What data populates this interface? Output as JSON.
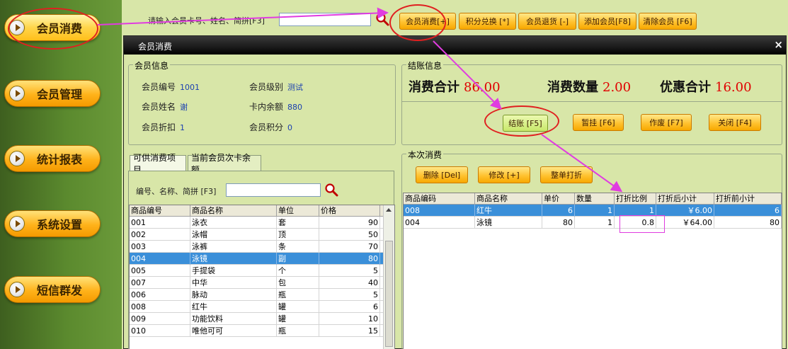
{
  "sidebar": {
    "items": [
      {
        "label": "会员消费"
      },
      {
        "label": "会员管理"
      },
      {
        "label": "统计报表"
      },
      {
        "label": "系统设置"
      },
      {
        "label": "短信群发"
      }
    ]
  },
  "topbar": {
    "search_label": "请输入会员卡号、姓名、简拼[F3]",
    "search_value": "",
    "buttons": [
      {
        "label": "会员消费[+]"
      },
      {
        "label": "积分兑换 [*]"
      },
      {
        "label": "会员退货 [-]"
      },
      {
        "label": "添加会员[F8]"
      },
      {
        "label": "清除会员 [F6]"
      }
    ]
  },
  "dialog": {
    "title": "会员消费",
    "close_glyph": "×",
    "member_info": {
      "group_label": "会员信息",
      "fields": [
        {
          "label": "会员编号",
          "value": "1001"
        },
        {
          "label": "会员级别",
          "value": "测试"
        },
        {
          "label": "会员姓名",
          "value": "谢"
        },
        {
          "label": "卡内余额",
          "value": "880"
        },
        {
          "label": "会员折扣",
          "value": "1"
        },
        {
          "label": "会员积分",
          "value": "0"
        }
      ]
    },
    "checkout": {
      "group_label": "结账信息",
      "total_label": "消费合计",
      "total_value": "86.00",
      "qty_label": "消费数量",
      "qty_value": "2.00",
      "discount_label": "优惠合计",
      "discount_value": "16.00",
      "buttons": [
        {
          "label": "结账 [F5]"
        },
        {
          "label": "暂挂 [F6]"
        },
        {
          "label": "作废 [F7]"
        },
        {
          "label": "关闭 [F4]"
        }
      ]
    },
    "tabs": [
      {
        "label": "可供消费项目"
      },
      {
        "label": "当前会员次卡余额"
      }
    ],
    "product_search": {
      "label": "编号、名称、简拼 [F3]",
      "value": ""
    },
    "product_grid": {
      "columns": [
        "商品编号",
        "商品名称",
        "单位",
        "价格"
      ],
      "rows": [
        [
          "001",
          "泳衣",
          "套",
          "90"
        ],
        [
          "002",
          "泳帽",
          "顶",
          "50"
        ],
        [
          "003",
          "泳裤",
          "条",
          "70"
        ],
        [
          "004",
          "泳镜",
          "副",
          "80"
        ],
        [
          "005",
          "手提袋",
          "个",
          "5"
        ],
        [
          "007",
          "中华",
          "包",
          "40"
        ],
        [
          "006",
          "脉动",
          "瓶",
          "5"
        ],
        [
          "008",
          "红牛",
          "罐",
          "6"
        ],
        [
          "009",
          "功能饮料",
          "罐",
          "10"
        ],
        [
          "010",
          "唯他可可",
          "瓶",
          "15"
        ]
      ],
      "selected_index": 3
    },
    "current_sale": {
      "group_label": "本次消费",
      "buttons": [
        {
          "label": "删除 [Del]"
        },
        {
          "label": "修改 [+]"
        },
        {
          "label": "整单打折"
        }
      ],
      "columns": [
        "商品编码",
        "商品名称",
        "单价",
        "数量",
        "打折比例",
        "打折后小计",
        "打折前小计"
      ],
      "rows": [
        [
          "008",
          "红牛",
          "6",
          "1",
          "1",
          "￥6.00",
          "6"
        ],
        [
          "004",
          "泳镜",
          "80",
          "1",
          "0.8",
          "￥64.00",
          "80"
        ]
      ],
      "selected_index": 0
    }
  },
  "colors": {
    "sidebar_green": "#5b8a2e",
    "button_orange": "#ffc230",
    "highlight_blue": "#3a8fd9",
    "total_red": "#e00000",
    "annotation_magenta": "#e03ce0",
    "annotation_red": "#e02020"
  }
}
